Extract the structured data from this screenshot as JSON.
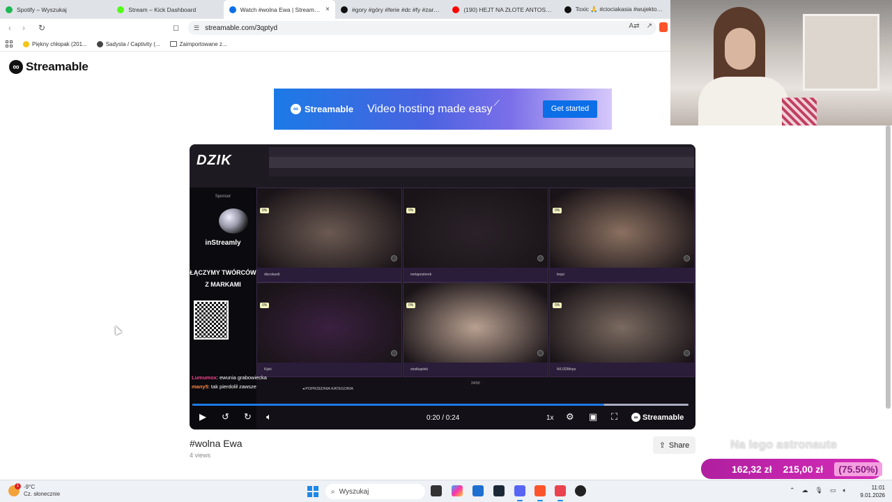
{
  "browser": {
    "tabs": [
      {
        "label": "Spotify – Wyszukaj",
        "icon": "spotify-icon",
        "color": "#1db954",
        "active": false
      },
      {
        "label": "Stream – Kick Dashboard",
        "icon": "kick-icon",
        "color": "#53fc18",
        "active": false
      },
      {
        "label": "Watch #wolna Ewa | Streamable",
        "icon": "streamable-icon",
        "color": "#0d6fe8",
        "active": true
      },
      {
        "label": "#gory #góry #ferie #dc #fy #zaręczy...",
        "icon": "tiktok-icon",
        "color": "#111111",
        "active": false
      },
      {
        "label": "(190) HEJT NA ZŁOTE ANTOSIE!? KO...",
        "icon": "youtube-icon",
        "color": "#ff0000",
        "active": false
      },
      {
        "label": "Toxic 🙏 #ciociakasia #wujektoxic...",
        "icon": "tiktok-icon",
        "color": "#111111",
        "active": false
      }
    ],
    "url": "streamable.com/3qptyd",
    "bookmarks": [
      {
        "label": "Piękny chłopak (201...",
        "icon": "emoji-icon"
      },
      {
        "label": "Sadysta / Captivity (...",
        "icon": "globe-icon"
      },
      {
        "label": "Zaimportowane z...",
        "icon": "folder-icon"
      }
    ]
  },
  "page": {
    "logo_text": "Streamable",
    "banner": {
      "brand": "Streamable",
      "tagline": "Video hosting made easy",
      "cta": "Get started"
    },
    "video": {
      "overlay_brand": "DZIK",
      "sponsor_label": "Sponsor",
      "instreamly": "inStreamly",
      "promo": "ŁĄCZYMY TWÓRCÓW Z MARKAMI",
      "participants": [
        {
          "name": "discokardi",
          "pct": "0%"
        },
        {
          "name": "metaposterek",
          "pct": "0%"
        },
        {
          "name": "lequt",
          "pct": "0%"
        },
        {
          "name": "Kijek",
          "pct": "0%"
        },
        {
          "name": "stodkapinki",
          "pct": "0%"
        },
        {
          "name": "WLODMnps",
          "pct": "0%"
        }
      ],
      "chat": [
        {
          "user": "Lumumox",
          "msg": ": ewunia grabowiecka"
        },
        {
          "user": "many5",
          "msg": ": tak pierdolił zawsze"
        }
      ],
      "category": "POPRZEDNIA KATEGORIA",
      "counter": "24/50",
      "current_time": "0:20",
      "duration": "0:24",
      "time_display": "0:20 / 0:24",
      "progress": 0.83,
      "buffered": 1.0,
      "speed": "1x",
      "player_brand": "Streamable"
    },
    "title": "#wolna Ewa",
    "views": "4 views",
    "share": "Share"
  },
  "overlay": {
    "text": "Na lego astronaute",
    "donation_current": "162,32 zł",
    "donation_goal": "215,00 zł",
    "donation_pct": "(75.50%)"
  },
  "taskbar": {
    "temp": "-9°C",
    "weather": "Cz. słonecznie",
    "weather_badge": "1",
    "search": "Wyszukaj",
    "time": "11:01",
    "date": "9.01.2026"
  },
  "colors": {
    "accent": "#0d6fe8",
    "donation": "#d62cb8"
  }
}
